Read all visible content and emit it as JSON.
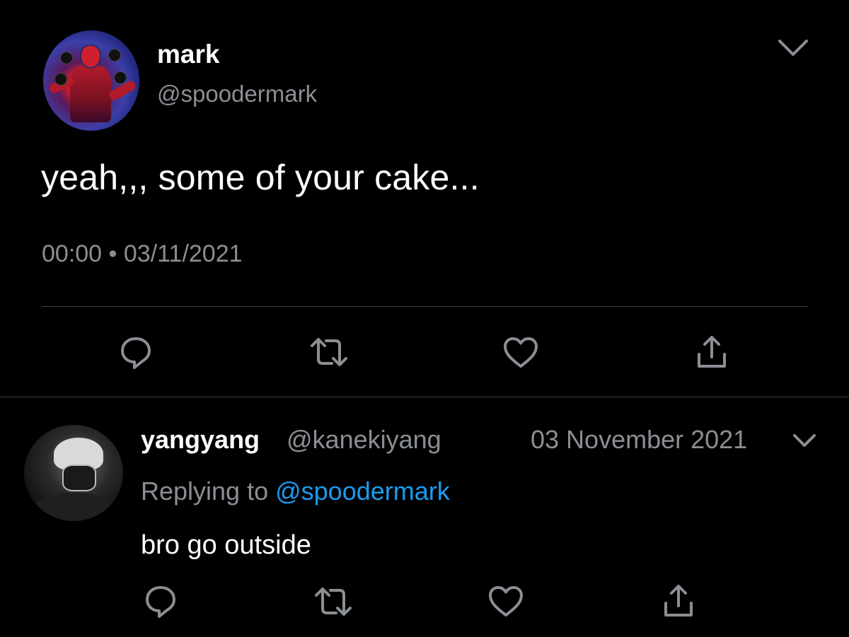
{
  "main_tweet": {
    "name": "mark",
    "handle": "@spoodermark",
    "text": "yeah,,, some of your cake...",
    "timestamp": "00:00 • 03/11/2021"
  },
  "reply_tweet": {
    "name": "yangyang",
    "handle": "@kanekiyang",
    "date": "03 November 2021",
    "replying_prefix": "Replying to ",
    "replying_mention": "@spoodermark",
    "text": "bro go outside"
  },
  "icons": [
    "chevron-down-icon",
    "reply-icon",
    "retweet-icon",
    "like-icon",
    "share-icon"
  ],
  "colors": {
    "background": "#000000",
    "text": "#ffffff",
    "secondary_text": "#8b8f94",
    "mention": "#1d9bf0",
    "divider": "#3b3e42"
  }
}
